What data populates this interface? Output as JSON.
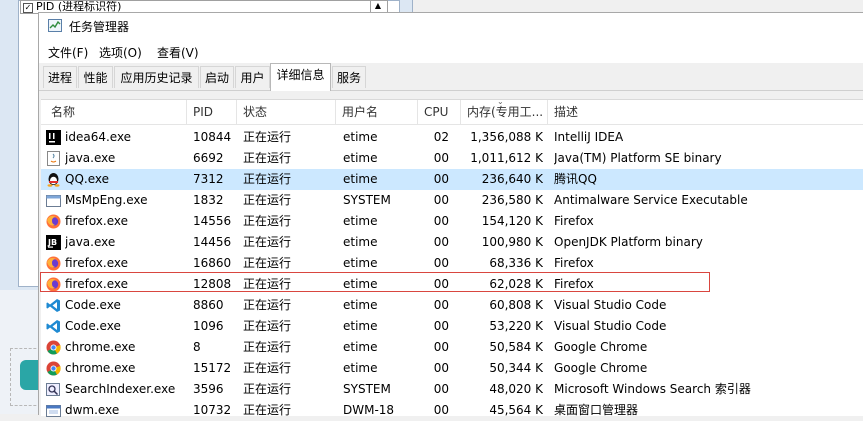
{
  "background": {
    "pid_row_label": "PID (进程标识符)"
  },
  "window": {
    "title": "任务管理器"
  },
  "menu": [
    {
      "label": "文件(F)"
    },
    {
      "label": "选项(O)"
    },
    {
      "label": "查看(V)"
    }
  ],
  "tabs": [
    {
      "label": "进程"
    },
    {
      "label": "性能"
    },
    {
      "label": "应用历史记录"
    },
    {
      "label": "启动"
    },
    {
      "label": "用户"
    },
    {
      "label": "详细信息",
      "active": true
    },
    {
      "label": "服务"
    }
  ],
  "columns": {
    "name": "名称",
    "pid": "PID",
    "status": "状态",
    "user": "用户名",
    "cpu": "CPU",
    "memory": "内存(专用工...",
    "description": "描述"
  },
  "processes": [
    {
      "name": "idea64.exe",
      "pid": "10844",
      "status": "正在运行",
      "user": "etime",
      "cpu": "02",
      "memory": "1,356,088 K",
      "description": "IntelliJ IDEA",
      "icon": "intellij-icon"
    },
    {
      "name": "java.exe",
      "pid": "6692",
      "status": "正在运行",
      "user": "etime",
      "cpu": "00",
      "memory": "1,011,612 K",
      "description": "Java(TM) Platform SE binary",
      "icon": "java-icon"
    },
    {
      "name": "QQ.exe",
      "pid": "7312",
      "status": "正在运行",
      "user": "etime",
      "cpu": "00",
      "memory": "236,640 K",
      "description": "腾讯QQ",
      "icon": "qq-icon",
      "selected": true
    },
    {
      "name": "MsMpEng.exe",
      "pid": "1832",
      "status": "正在运行",
      "user": "SYSTEM",
      "cpu": "00",
      "memory": "236,580 K",
      "description": "Antimalware Service Executable",
      "icon": "generic-exe-icon"
    },
    {
      "name": "firefox.exe",
      "pid": "14556",
      "status": "正在运行",
      "user": "etime",
      "cpu": "00",
      "memory": "154,120 K",
      "description": "Firefox",
      "icon": "firefox-icon"
    },
    {
      "name": "java.exe",
      "pid": "14456",
      "status": "正在运行",
      "user": "etime",
      "cpu": "00",
      "memory": "100,980 K",
      "description": "OpenJDK Platform binary",
      "icon": "jetbrains-icon"
    },
    {
      "name": "firefox.exe",
      "pid": "16860",
      "status": "正在运行",
      "user": "etime",
      "cpu": "00",
      "memory": "68,336 K",
      "description": "Firefox",
      "icon": "firefox-icon"
    },
    {
      "name": "firefox.exe",
      "pid": "12808",
      "status": "正在运行",
      "user": "etime",
      "cpu": "00",
      "memory": "62,028 K",
      "description": "Firefox",
      "icon": "firefox-icon",
      "highlighted": true
    },
    {
      "name": "Code.exe",
      "pid": "8860",
      "status": "正在运行",
      "user": "etime",
      "cpu": "00",
      "memory": "60,808 K",
      "description": "Visual Studio Code",
      "icon": "vscode-icon"
    },
    {
      "name": "Code.exe",
      "pid": "1096",
      "status": "正在运行",
      "user": "etime",
      "cpu": "00",
      "memory": "53,220 K",
      "description": "Visual Studio Code",
      "icon": "vscode-icon"
    },
    {
      "name": "chrome.exe",
      "pid": "8",
      "status": "正在运行",
      "user": "etime",
      "cpu": "00",
      "memory": "50,584 K",
      "description": "Google Chrome",
      "icon": "chrome-icon"
    },
    {
      "name": "chrome.exe",
      "pid": "15172",
      "status": "正在运行",
      "user": "etime",
      "cpu": "00",
      "memory": "50,344 K",
      "description": "Google Chrome",
      "icon": "chrome-icon"
    },
    {
      "name": "SearchIndexer.exe",
      "pid": "3596",
      "status": "正在运行",
      "user": "SYSTEM",
      "cpu": "00",
      "memory": "48,020 K",
      "description": "Microsoft Windows Search 索引器",
      "icon": "search-indexer-icon"
    },
    {
      "name": "dwm.exe",
      "pid": "10732",
      "status": "正在运行",
      "user": "DWM-18",
      "cpu": "00",
      "memory": "45,564 K",
      "description": "桌面窗口管理器",
      "icon": "dwm-icon"
    }
  ],
  "colors": {
    "selected_row": "#cce8ff",
    "highlight_border": "#d9463f"
  }
}
